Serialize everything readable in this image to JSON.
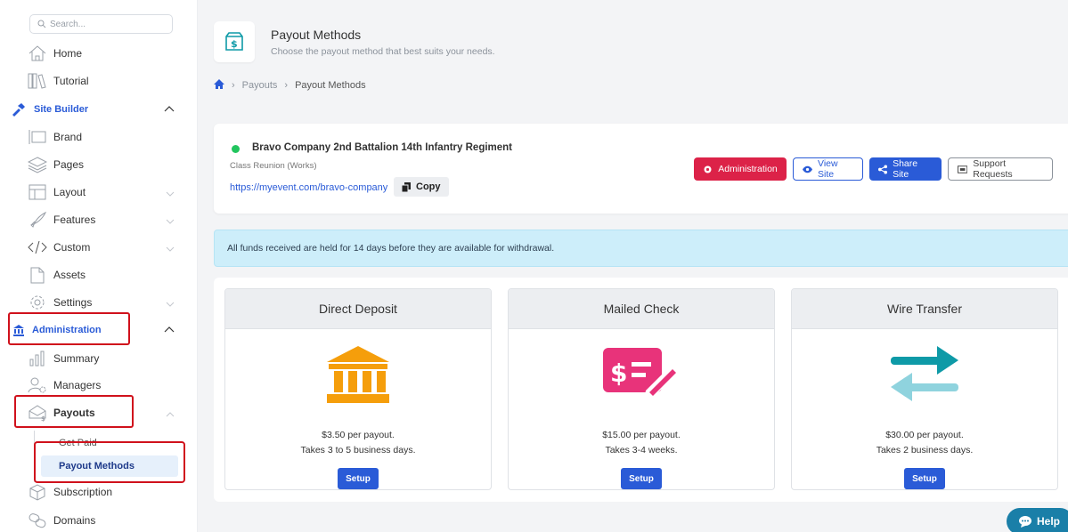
{
  "sidebar": {
    "search_placeholder": "Search...",
    "items": {
      "home": "Home",
      "tutorial": "Tutorial",
      "site_builder": "Site Builder",
      "brand": "Brand",
      "pages": "Pages",
      "layout": "Layout",
      "features": "Features",
      "custom": "Custom",
      "assets": "Assets",
      "settings": "Settings",
      "administration": "Administration",
      "summary": "Summary",
      "managers": "Managers",
      "payouts": "Payouts",
      "get_paid": "Get Paid",
      "payout_methods": "Payout Methods",
      "subscription": "Subscription",
      "domains": "Domains"
    }
  },
  "header": {
    "title": "Payout Methods",
    "subtitle": "Choose the payout method that best suits your needs.",
    "breadcrumb": [
      "Payouts",
      "Payout Methods"
    ]
  },
  "site": {
    "name": "Bravo Company 2nd Battalion 14th Infantry Regiment",
    "type": "Class Reunion (Works)",
    "url": "https://myevent.com/bravo-company",
    "copy_label": "Copy",
    "buttons": {
      "administration": "Administration",
      "view_site": "View Site",
      "share_site": "Share Site",
      "support": "Support Requests"
    }
  },
  "alert": "All funds received are held for 14 days before they are available for withdrawal.",
  "methods": [
    {
      "title": "Direct Deposit",
      "price": "$3.50 per payout.",
      "time": "Takes 3 to 5 business days.",
      "setup": "Setup"
    },
    {
      "title": "Mailed Check",
      "price": "$15.00 per payout.",
      "time": "Takes 3-4 weeks.",
      "setup": "Setup"
    },
    {
      "title": "Wire Transfer",
      "price": "$30.00 per payout.",
      "time": "Takes 2 business days.",
      "setup": "Setup"
    }
  ],
  "help_label": "Help",
  "colors": {
    "primary": "#2a5bd7",
    "danger": "#dc2248",
    "success": "#22c55e",
    "bank": "#f59e0b",
    "check": "#e8337a",
    "wire_top": "#0e9aa7",
    "wire_bottom": "#8fd3de",
    "help": "#1a7fa8"
  }
}
